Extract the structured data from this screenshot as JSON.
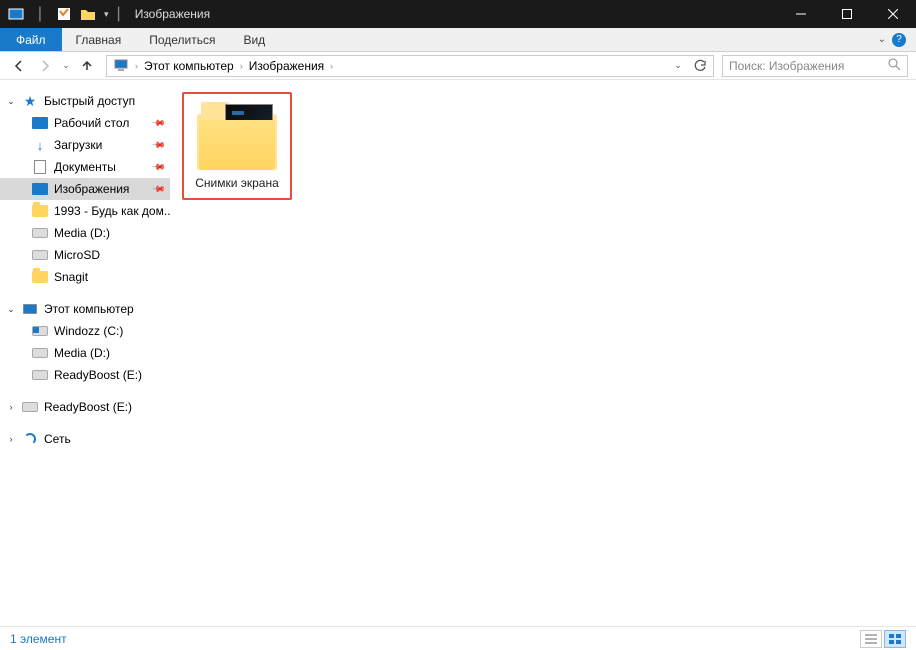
{
  "titlebar": {
    "title": "Изображения"
  },
  "ribbon": {
    "file": "Файл",
    "tabs": [
      "Главная",
      "Поделиться",
      "Вид"
    ]
  },
  "breadcrumb": {
    "root": "Этот компьютер",
    "current": "Изображения"
  },
  "search": {
    "placeholder": "Поиск: Изображения"
  },
  "sidebar": {
    "quick_access": "Быстрый доступ",
    "quick_items": [
      {
        "label": "Рабочий стол",
        "icon": "desktop",
        "pinned": true
      },
      {
        "label": "Загрузки",
        "icon": "downloads",
        "pinned": true
      },
      {
        "label": "Документы",
        "icon": "documents",
        "pinned": true
      },
      {
        "label": "Изображения",
        "icon": "images",
        "pinned": true,
        "selected": true
      },
      {
        "label": "1993 - Будь как дом...",
        "icon": "folder",
        "pinned": false
      },
      {
        "label": "Media (D:)",
        "icon": "drive",
        "pinned": false
      },
      {
        "label": "MicroSD",
        "icon": "drive",
        "pinned": false
      },
      {
        "label": "Snagit",
        "icon": "folder",
        "pinned": false
      }
    ],
    "this_pc": "Этот компьютер",
    "pc_items": [
      {
        "label": "Windozz (C:)",
        "icon": "osdrive"
      },
      {
        "label": "Media (D:)",
        "icon": "drive"
      },
      {
        "label": "ReadyBoost (E:)",
        "icon": "drive"
      }
    ],
    "extra_items": [
      {
        "label": "ReadyBoost (E:)",
        "icon": "drive"
      }
    ],
    "network": "Сеть"
  },
  "content": {
    "items": [
      {
        "label": "Снимки экрана"
      }
    ]
  },
  "status": {
    "count_label": "1 элемент"
  }
}
